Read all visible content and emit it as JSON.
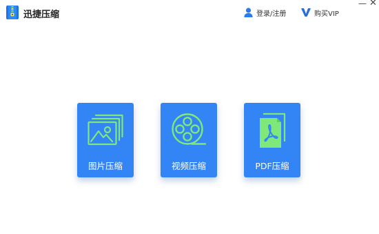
{
  "app": {
    "title": "迅捷压缩",
    "logo_icon": "zip-file-icon"
  },
  "header": {
    "login_label": "登录/注册",
    "login_icon": "user-icon",
    "vip_label": "购买VIP",
    "vip_icon": "vip-v-icon"
  },
  "window_controls": {
    "minimize": "—",
    "close": "✕"
  },
  "colors": {
    "accent": "#3385f6",
    "icon_green": "#7fe87a",
    "logo_blue": "#1f73e8"
  },
  "cards": [
    {
      "label": "图片压缩",
      "icon": "image-stack-icon"
    },
    {
      "label": "视频压缩",
      "icon": "film-reel-icon"
    },
    {
      "label": "PDF压缩",
      "icon": "pdf-file-icon"
    }
  ]
}
